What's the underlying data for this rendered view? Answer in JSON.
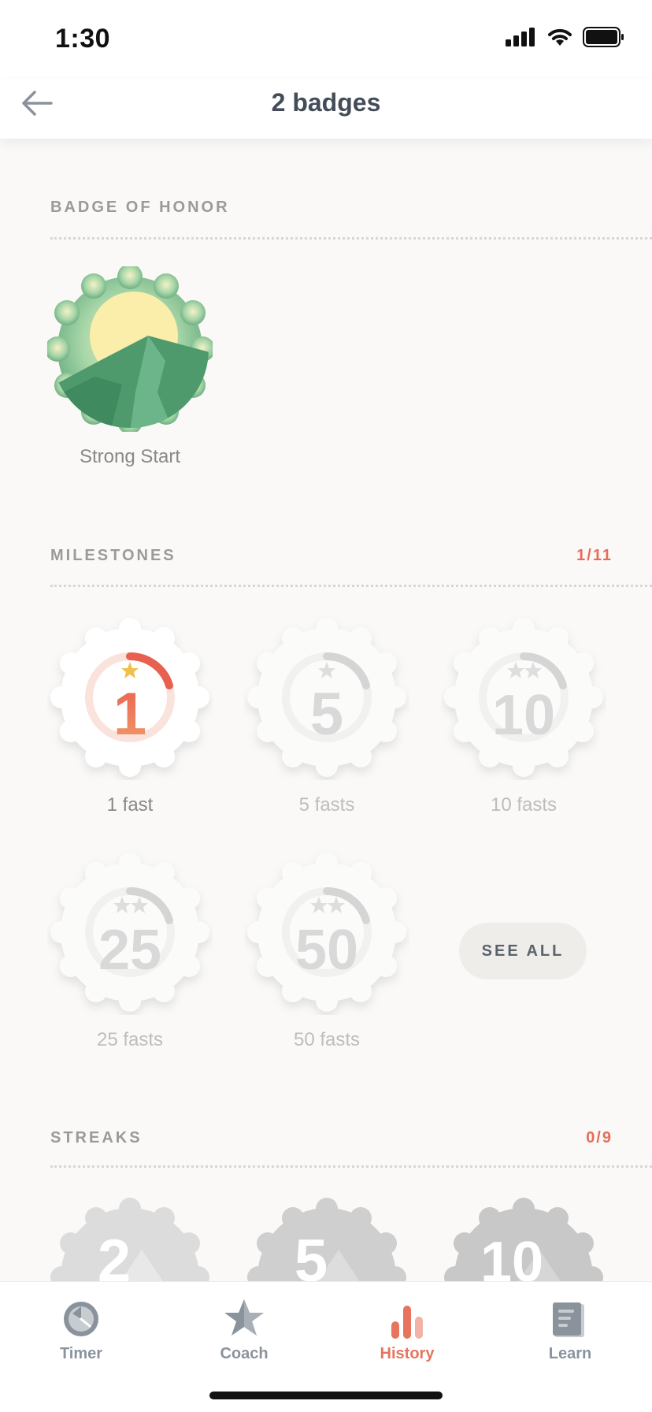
{
  "status_bar": {
    "time": "1:30"
  },
  "header": {
    "title": "2 badges",
    "back_icon": "arrow-left-icon"
  },
  "badge_of_honor": {
    "title": "BADGE OF HONOR",
    "badges": [
      {
        "label": "Strong Start",
        "icon": "mountain-sunrise-badge-icon"
      }
    ]
  },
  "milestones": {
    "title": "MILESTONES",
    "count": "1/11",
    "badges": [
      {
        "number": "1",
        "label": "1 fast",
        "stars": 1,
        "achieved": true,
        "progress": 0.4
      },
      {
        "number": "5",
        "label": "5 fasts",
        "stars": 1,
        "achieved": false,
        "progress": 0.4
      },
      {
        "number": "10",
        "label": "10 fasts",
        "stars": 2,
        "achieved": false,
        "progress": 0.4
      },
      {
        "number": "25",
        "label": "25 fasts",
        "stars": 2,
        "achieved": false,
        "progress": 0.4
      },
      {
        "number": "50",
        "label": "50 fasts",
        "stars": 2,
        "achieved": false,
        "progress": 0.4
      }
    ],
    "see_all_label": "SEE ALL"
  },
  "streaks": {
    "title": "STREAKS",
    "count": "0/9",
    "badges": [
      {
        "number": "2"
      },
      {
        "number": "5"
      },
      {
        "number": "10"
      }
    ]
  },
  "tabbar": {
    "tabs": [
      {
        "label": "Timer",
        "icon": "timer-icon",
        "active": false
      },
      {
        "label": "Coach",
        "icon": "star-icon",
        "active": false
      },
      {
        "label": "History",
        "icon": "bar-chart-icon",
        "active": true
      },
      {
        "label": "Learn",
        "icon": "book-icon",
        "active": false
      }
    ]
  },
  "colors": {
    "accent": "#e6745f",
    "title": "#434c57",
    "badge_green": "#5fa77b"
  }
}
